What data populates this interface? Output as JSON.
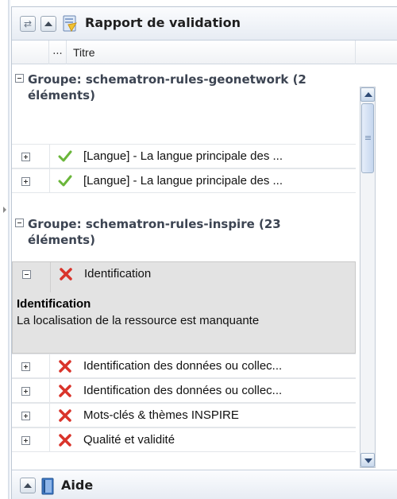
{
  "panel": {
    "title": "Rapport de validation",
    "refresh_icon": "refresh-icon",
    "collapse_icon": "collapse-up-icon",
    "report_icon": "report-icon"
  },
  "columns": {
    "more": "...",
    "titre": "Titre"
  },
  "groups": [
    {
      "label": "Groupe: schematron-rules-geonetwork (2 éléments)",
      "items": [
        {
          "status": "passed",
          "label": "[Langue] - La langue principale des ..."
        },
        {
          "status": "passed",
          "label": "[Langue] - La langue principale des ..."
        }
      ]
    },
    {
      "label": "Groupe: schematron-rules-inspire (23 éléments)",
      "expanded_item": {
        "status": "failed",
        "label": "Identification",
        "detail_title": "Identification",
        "detail_text": "La localisation de la ressource est manquante"
      },
      "items": [
        {
          "status": "failed",
          "label": "Identification des données ou collec..."
        },
        {
          "status": "failed",
          "label": "Identification des données ou collec..."
        },
        {
          "status": "failed",
          "label": "Mots-clés & thèmes INSPIRE"
        },
        {
          "status": "failed",
          "label": "Qualité et validité"
        }
      ]
    }
  ],
  "footer": {
    "title": "Aide",
    "icon": "book-icon"
  },
  "colors": {
    "pass": "#6ab63a",
    "fail": "#d9342b",
    "selected_row": "#e3e3e3",
    "group_text": "#3c4452"
  }
}
